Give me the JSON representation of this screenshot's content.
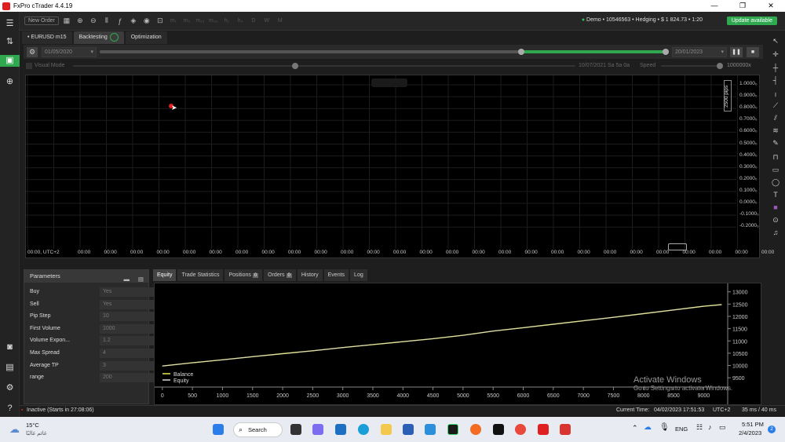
{
  "window": {
    "title": "FxPro cTrader 4.4.19",
    "controls": [
      "—",
      "❐",
      "✕"
    ]
  },
  "toolbar": {
    "new_order": "New Order",
    "timeframes": [
      "m₁",
      "m₅",
      "m₁₅",
      "m₃₀",
      "h₁",
      "h₄",
      "D",
      "W",
      "M"
    ],
    "account": "Demo • 10546563 • Hedging • $ 1 824.73 • 1:20",
    "update": "Update available"
  },
  "tabs": {
    "symbol": "EURUSD",
    "timeframe": "m15",
    "backtesting": "Backtesting",
    "optimization": "Optimization"
  },
  "controls": {
    "start_date": "01/05/2020",
    "end_date": "20/01/2023",
    "progress": 0.97
  },
  "visual": {
    "label": "Visual Mode",
    "current_date": "10/07/2021 Sa 5a 0a",
    "speed_label": "Speed",
    "speed_value": "1000000x"
  },
  "chart": {
    "pips_label": "2500 pips",
    "yticks": [
      "1.0000₀",
      "0.9000₀",
      "0.8000₀",
      "0.7000₀",
      "0.6000₀",
      "0.5000₀",
      "0.4000₀",
      "0.3000₀",
      "0.2000₀",
      "0.1000₀",
      "0.0000₀",
      "-0.1000₀",
      "-0.2000₀"
    ],
    "xticks": [
      "00:00, UTC+2",
      "00:00",
      "00:00",
      "00:00",
      "00:00",
      "00:00",
      "00:00",
      "00:00",
      "00:00",
      "00:00",
      "00:00",
      "00:00",
      "00:00",
      "00:00",
      "00:00",
      "00:00",
      "00:00",
      "00:00",
      "00:00",
      "00:00",
      "00:00",
      "00:00",
      "00:00",
      "00:00",
      "00:00",
      "00:00",
      "00:00",
      "00:00"
    ]
  },
  "params": {
    "title": "Parameters",
    "rows": [
      {
        "label": "Buy",
        "value": "Yes"
      },
      {
        "label": "Sell",
        "value": "Yes"
      },
      {
        "label": "Pip Step",
        "value": "10"
      },
      {
        "label": "First Volume",
        "value": "1000"
      },
      {
        "label": "Volume Expon...",
        "value": "1.2"
      },
      {
        "label": "Max Spread",
        "value": "4"
      },
      {
        "label": "Average TP",
        "value": "3"
      },
      {
        "label": "range",
        "value": "200"
      }
    ]
  },
  "result_tabs": {
    "equity": "Equity",
    "trade_stats": "Trade Statistics",
    "positions": "Positions",
    "positions_count": "0",
    "orders": "Orders",
    "orders_count": "0",
    "history": "History",
    "events": "Events",
    "log": "Log"
  },
  "chart_data": {
    "type": "line",
    "x": [
      0,
      500,
      1000,
      1500,
      2000,
      2500,
      3000,
      3500,
      4000,
      4500,
      5000,
      5500,
      6000,
      6500,
      7000,
      7500,
      8000,
      8500,
      9000,
      9300
    ],
    "series": [
      {
        "name": "Balance",
        "values": [
          9980,
          10110,
          10230,
          10360,
          10480,
          10600,
          10730,
          10850,
          10970,
          11090,
          11230,
          11400,
          11540,
          11680,
          11820,
          11960,
          12110,
          12260,
          12410,
          12480
        ]
      },
      {
        "name": "Equity",
        "values": [
          9980,
          10110,
          10230,
          10360,
          10480,
          10600,
          10730,
          10850,
          10970,
          11090,
          11230,
          11400,
          11540,
          11680,
          11820,
          11960,
          12110,
          12260,
          12410,
          12480
        ]
      }
    ],
    "xticks": [
      "0",
      "500",
      "1000",
      "1500",
      "2000",
      "2500",
      "3000",
      "3500",
      "4000",
      "4500",
      "5000",
      "5500",
      "6000",
      "6500",
      "7000",
      "7500",
      "8000",
      "8500",
      "9000"
    ],
    "yticks": [
      "13000",
      "12500",
      "12000",
      "11500",
      "11000",
      "10500",
      "10000",
      "9500"
    ],
    "xlim": [
      -50,
      9400
    ],
    "ylim": [
      9250,
      13150
    ],
    "color": "#e8e84a",
    "legend": "bottom-left"
  },
  "status": {
    "state": "Inactive (Starts in 27:08:06)",
    "current_time_label": "Current Time:",
    "current_time": "04/02/2023 17:51:53",
    "timezone": "UTC+2",
    "latency": "35 ms / 40 ms"
  },
  "watermark": {
    "title": "Activate Windows",
    "sub": "Go to Settings to activate Windows."
  },
  "taskbar": {
    "temp": "15°C",
    "weather": "غائم غالبًا",
    "search": "Search",
    "lang": "ENG",
    "time": "5:51 PM",
    "date": "2/4/2023",
    "badge": "2"
  }
}
